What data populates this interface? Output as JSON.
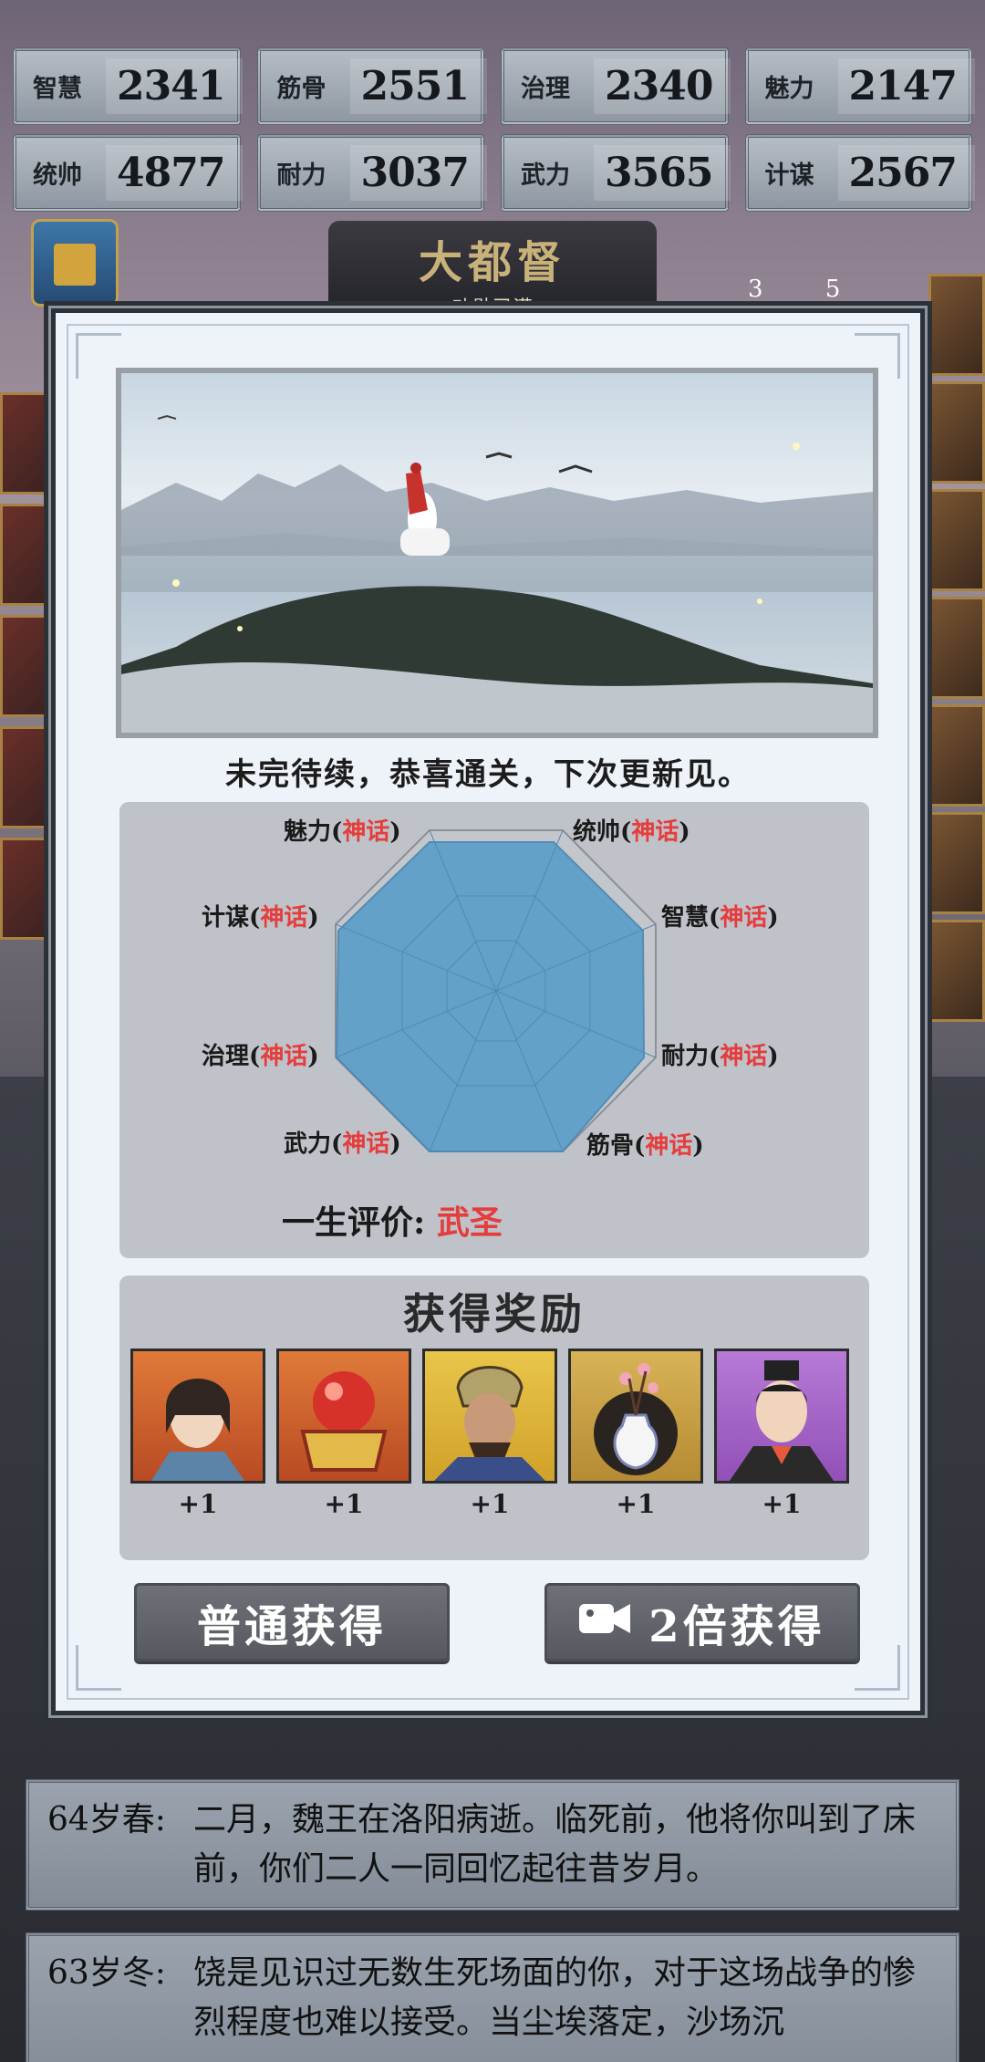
{
  "stats": [
    {
      "label": "智慧",
      "value": "2341"
    },
    {
      "label": "筋骨",
      "value": "2551"
    },
    {
      "label": "治理",
      "value": "2340"
    },
    {
      "label": "魅力",
      "value": "2147"
    },
    {
      "label": "统帅",
      "value": "4877"
    },
    {
      "label": "耐力",
      "value": "3037"
    },
    {
      "label": "武力",
      "value": "3565"
    },
    {
      "label": "计谋",
      "value": "2567"
    }
  ],
  "rank_title": "大都督",
  "rank_subtitle": "功勋已满",
  "badges": {
    "left": "3",
    "right": "5"
  },
  "modal": {
    "ending_text": "未完待续，恭喜通关，下次更新见。",
    "radar_labels": [
      {
        "name": "魅力",
        "grade": "神话"
      },
      {
        "name": "统帅",
        "grade": "神话"
      },
      {
        "name": "智慧",
        "grade": "神话"
      },
      {
        "name": "耐力",
        "grade": "神话"
      },
      {
        "name": "筋骨",
        "grade": "神话"
      },
      {
        "name": "武力",
        "grade": "神话"
      },
      {
        "name": "治理",
        "grade": "神话"
      },
      {
        "name": "计谋",
        "grade": "神话"
      }
    ],
    "verdict_label": "一生评价:",
    "verdict_value": "武圣",
    "rewards_title": "获得奖励",
    "rewards": [
      {
        "icon": "female-general-portrait",
        "count": "+1"
      },
      {
        "icon": "red-orb-chest-icon",
        "count": "+1"
      },
      {
        "icon": "armored-general-portrait",
        "count": "+1"
      },
      {
        "icon": "plum-blossom-vase-icon",
        "count": "+1"
      },
      {
        "icon": "scholar-portrait",
        "count": "+1"
      }
    ],
    "normal_button": "普通获得",
    "double_button": "2倍获得"
  },
  "log": [
    {
      "age": "64岁春:",
      "text": "二月，魏王在洛阳病逝。临死前，他将你叫到了床前，你们二人一同回忆起往昔岁月。"
    },
    {
      "age": "63岁冬:",
      "text": "饶是见识过无数生死场面的你，对于这场战争的惨烈程度也难以接受。当尘埃落定，沙场沉"
    }
  ],
  "colors": {
    "accent_red": "#e53c3c",
    "radar_fill": "#5b9ec9"
  }
}
